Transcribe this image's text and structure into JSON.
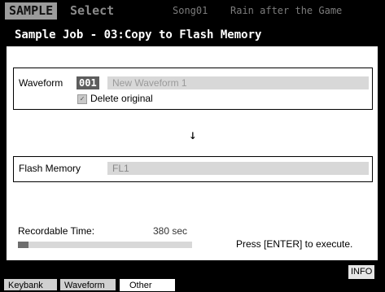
{
  "header": {
    "mode": "SAMPLE",
    "screen": "Select",
    "song": "Song01",
    "song_name": "Rain after the Game"
  },
  "job": {
    "title": "Sample Job - 03:Copy to Flash Memory"
  },
  "source": {
    "label": "Waveform",
    "number": "001",
    "name": "New Waveform 1",
    "delete_label": "Delete original",
    "delete_checked": true
  },
  "arrow": "↓",
  "destination": {
    "label": "Flash Memory",
    "value": "FL1"
  },
  "recordable": {
    "label": "Recordable Time:",
    "value": "380 sec",
    "level": 0.06
  },
  "prompt": "Press [ENTER] to execute.",
  "info_label": "INFO",
  "tabs": [
    {
      "label": "Keybank",
      "active": false
    },
    {
      "label": "Waveform",
      "active": false
    },
    {
      "label": "Other",
      "active": true
    }
  ],
  "colors": {
    "title_bg": "#000000",
    "panel_bg": "#ffffff",
    "field_dark": "#5d5d5d",
    "field_light": "#d8d8d8"
  }
}
